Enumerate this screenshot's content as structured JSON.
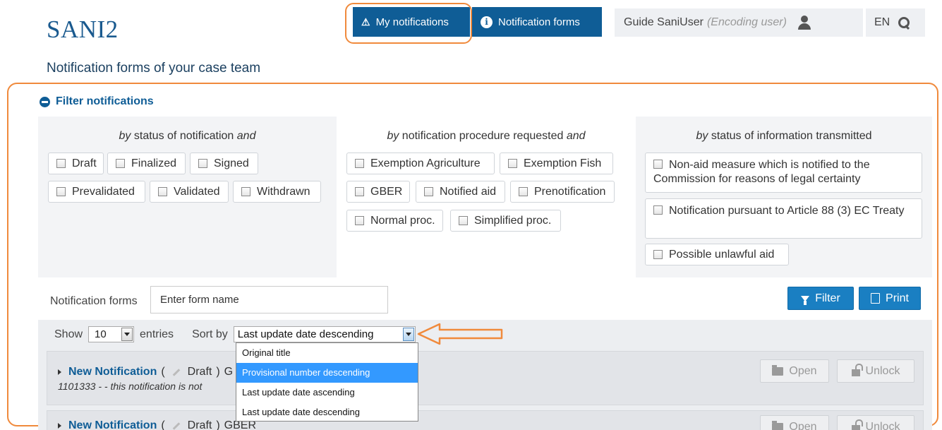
{
  "app": {
    "logo": "SANI2"
  },
  "nav": {
    "my_notifications": "My notifications",
    "notification_forms": "Notification forms",
    "user_name": "Guide SaniUser",
    "user_role": "(Encoding user)",
    "language": "EN"
  },
  "page": {
    "subtitle": "Notification forms of your case team"
  },
  "filters": {
    "heading": "Filter notifications",
    "status": {
      "title_prefix": "by",
      "title_main": "status of notification",
      "title_suffix": "and",
      "items": [
        "Draft",
        "Finalized",
        "Signed",
        "Prevalidated",
        "Validated",
        "Withdrawn"
      ]
    },
    "procedure": {
      "title_prefix": "by",
      "title_main": "notification procedure requested",
      "title_suffix": "and",
      "items": [
        "Exemption Agriculture",
        "Exemption Fish",
        "GBER",
        "Notified aid",
        "Prenotification",
        "Normal proc.",
        "Simplified proc."
      ]
    },
    "info": {
      "title_prefix": "by",
      "title_main": "status of information transmitted",
      "items": [
        "Non-aid measure which is notified to the Commission for reasons of legal certainty",
        "Notification pursuant to Article 88 (3) EC Treaty",
        "Possible unlawful aid"
      ]
    }
  },
  "search": {
    "label": "Notification forms",
    "placeholder": "Enter form name",
    "filter_button": "Filter",
    "print_button": "Print"
  },
  "list_controls": {
    "show_label": "Show",
    "entries_value": "10",
    "entries_label": "entries",
    "sort_label": "Sort by",
    "sort_value": "Last update date descending",
    "sort_options": [
      "Original title",
      "Provisional number descending",
      "Last update date ascending",
      "Last update date descending"
    ],
    "highlighted_option_index": 1
  },
  "cards": [
    {
      "title": "New Notification",
      "status": "Draft",
      "status_tail": "G",
      "subtitle": "1101333 - - this notification is not",
      "open_label": "Open",
      "unlock_label": "Unlock"
    },
    {
      "title": "New Notification",
      "status": "Draft",
      "status_tail": "GBER",
      "open_label": "Open",
      "unlock_label": "Unlock"
    }
  ],
  "colors": {
    "brand_blue": "#0f5d96",
    "button_blue": "#1a7fc2",
    "annotation_orange": "#f08a3c",
    "dropdown_highlight": "#3399ff"
  }
}
